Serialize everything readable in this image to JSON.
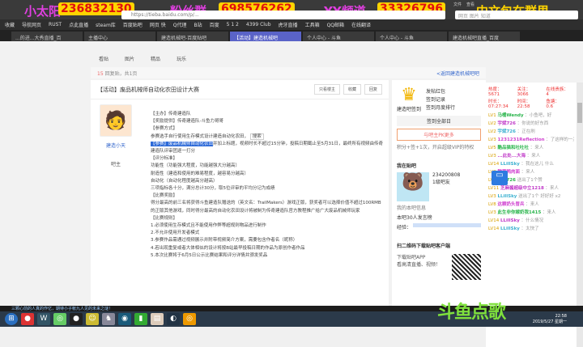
{
  "overlay": {
    "qq_group_label": "小太阳",
    "qq_group": "236832130",
    "fan_group_label": "粉丝群",
    "fan_group": "698576262",
    "yy_label": "YY频道",
    "yy": "33326796",
    "slogan": "中文包在群里"
  },
  "browser": {
    "url": "https://tieba.baidu.com/p/...",
    "search_placeholder": "网页 图片 知道",
    "menu": [
      "文件",
      "查看"
    ],
    "bookmarks": [
      "收藏",
      "导航网页",
      "RUST",
      "点此直播",
      "steam库",
      "百度贴吧",
      "网页 快",
      "Q代理",
      "B站",
      "百度",
      "5 1 2",
      "4399 Club",
      "虎牙直播",
      "工具箱",
      "QQ邮箱",
      "在线翻译"
    ],
    "tabs": [
      "...的进...大秀直播_百",
      "主播中心",
      "建造机械吧-百度贴吧",
      "【活动】建造机械吧",
      "个人中心 - 斗鱼",
      "个人中心 - 斗鱼",
      "建造机械吧直播_百度"
    ]
  },
  "forum": {
    "nav": [
      "看贴",
      "图片",
      "精品",
      "玩乐"
    ],
    "reply_count": "15",
    "crumb_text": "回复贴，共1页",
    "back_link": "<返回建造机械吧吧",
    "post_title": "【活动】废品机械师自动化农田设计大赛",
    "buttons": [
      "只看楼主",
      "收藏",
      "回复"
    ],
    "author": {
      "name": "建造小天",
      "level": "吧主"
    },
    "body": [
      "【主办】传奇建造队",
      "【奖励提供】传奇建造队-斗鱼力哥哥",
      "【参赛方式】",
      "参赛选手自行使用生存模式设计建造自动化农田，",
      "【参赛】废品机械师自动化农田",
      "并加上标题，视频时长不超过15分钟，投稿日期截止至5月31日，最终所有视频由传奇建造队评审团逐一打分",
      "【评分标准】",
      "功能性（功能强大程度，功能越强大分越高）",
      "耐造性（建造和使用的难易程度，越容易分越高）",
      "自动化（自动化程度越高分越高）",
      "三项指标各十分，满分总计30分，取5位评审的平均分记为成绩",
      "【比赛奖励】",
      "得分最高的前三名将获得斗鱼建造队赠送的（英文名：TrailMakers）游戏正版，获奖者可以选择价值不超过100RMB的正版其他游戏，同时得分最高的自动化农田设计将被制为传奇建造队官方教程推广给广大废品机械师玩家",
      "【比赛规则】",
      "1.必须使用生存模式且不能使用作弊等超规则物品进行制作",
      "2.不允许使用开发者模式",
      "3.参赛作品需通过视频展示并附带视频简介方案，需要包含作者名（昵称）",
      "4.若出现重复或者大体相似的设计将按B站最早投稿日期的作品为原创作者作品",
      "5.本次比赛将于6月5日公示比赛结果和评分详情并颁发奖品"
    ],
    "search_popup": "搜索",
    "side": {
      "sign_title": "建造吧签到",
      "links": [
        "发帖红包",
        "签到记录",
        "签到月度排行"
      ],
      "btn1": "签到全部日",
      "btn2": "与吧主PK更多",
      "tip": "积分+签+1次，开启超级VIP的特权",
      "my_title": "我在贴吧",
      "uid": "234200808",
      "level_badge": "1级吧友",
      "member": "我的本吧信息",
      "rank": "本吧30人发言榜",
      "exp_label": "经验：",
      "qr_title": "扫二维码下载贴吧客户端",
      "qr_lines": [
        "下载贴吧APP",
        "看高清直播、视频！"
      ]
    }
  },
  "chat": {
    "stats": [
      [
        "热度：",
        "5671"
      ],
      [
        "关注：",
        "3066"
      ],
      [
        "在线贵族：",
        "4"
      ],
      [
        "时长：",
        "07:27:34"
      ],
      [
        "时间：",
        "22:58"
      ],
      [
        "鱼塘：",
        "0.6"
      ]
    ],
    "messages": [
      [
        "LV1",
        "马桶Wendy",
        "：小鱼吧，好"
      ],
      [
        "LV2",
        "宇斌726",
        "：你说的好东西"
      ],
      [
        "LV2",
        "宇斌726",
        "：正在刷"
      ],
      [
        "LV3",
        "1231231Reflection",
        "：了这样的一关"
      ],
      [
        "LV5",
        "酷品猫和吐吐吐",
        "：来人"
      ],
      [
        "LV3",
        "...此处...大海",
        "：来人"
      ],
      [
        "LV14",
        "LLillSky",
        "：我在这儿 什么"
      ],
      [
        "LV3",
        "酸菜鸭肉面",
        "：来人"
      ],
      [
        "LV3",
        "宇斌726",
        "送出了1个赞"
      ],
      [
        "LV11",
        "芝麻酱超级中立1218",
        "：来人"
      ],
      [
        "LV3",
        "LLillSky",
        "送出了1个 好好好 x2"
      ],
      [
        "LV8",
        "这颗奶头冒兵",
        "：来人"
      ],
      [
        "LV3",
        "此生非你嫁奶我1415",
        "：来人"
      ],
      [
        "LV14",
        "LLillSky",
        "：什么情况"
      ],
      [
        "LV14",
        "LLillSky",
        "：太快了"
      ]
    ]
  },
  "status_bar": "三颗心前的人真的作亿，期待小子帐九人见的未来之谜！",
  "taskbar": {
    "time": "22:58",
    "date": "2019/5/27 星期一",
    "watermark": "斗鱼点歌"
  }
}
